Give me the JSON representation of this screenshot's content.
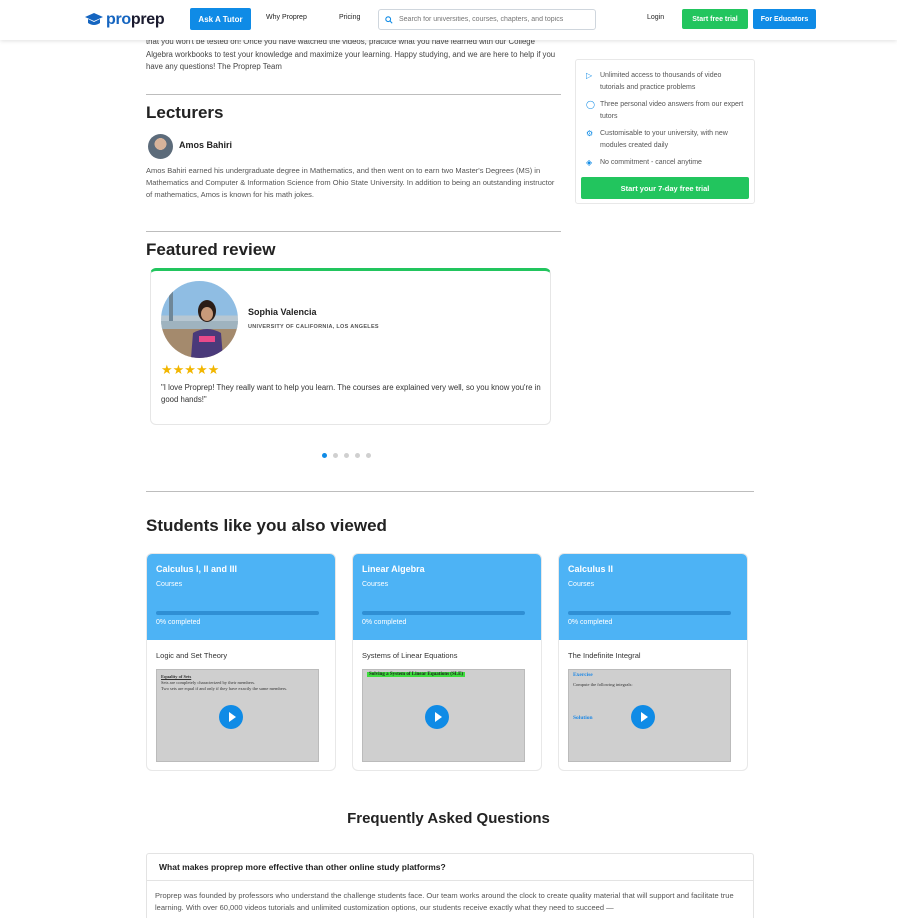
{
  "header": {
    "logo_text_1": "pro",
    "logo_text_2": "prep",
    "ask_tutor": "Ask A Tutor",
    "why_proprep": "Why Proprep",
    "pricing": "Pricing",
    "search_placeholder": "Search for universities, courses, chapters, and topics",
    "login": "Login",
    "start_free_trial": "Start free trial",
    "for_educators": "For Educators"
  },
  "intro_text": "that you won't be tested on! Once you have watched the videos, practice what you have learned with our College Algebra workbooks to test your knowledge and maximize your learning. Happy studying, and we are here to help if you have any questions! The Proprep Team",
  "lecturers": {
    "title": "Lecturers",
    "name": "Amos Bahiri",
    "bio": "Amos Bahiri earned his undergraduate degree in Mathematics, and then went on to earn two Master's Degrees (MS) in Mathematics and Computer & Information Science from Ohio State University. In addition to being an outstanding instructor of mathematics, Amos is known for his math jokes."
  },
  "review": {
    "title": "Featured review",
    "name": "Sophia Valencia",
    "school": "UNIVERSITY OF CALIFORNIA, LOS ANGELES",
    "stars": "★★★★★",
    "rating": 5,
    "text": "\"I love Proprep! They really want to help you learn. The courses are explained very well, so you know you're in good hands!\"",
    "active_slide": 1,
    "slide_count": 5
  },
  "sidebar": {
    "features": [
      "Unlimited access to thousands of video tutorials and practice problems",
      "Three personal video answers from our expert tutors",
      "Customisable to your university, with new modules created daily",
      "No commitment - cancel anytime"
    ],
    "cta": "Start your 7-day free trial"
  },
  "also_viewed": {
    "title": "Students like you also viewed",
    "courses": [
      {
        "title": "Calculus I, II and III",
        "sub": "Courses",
        "progress": "0% completed",
        "topic": "Logic and Set Theory",
        "thumb_lines": [
          "Equality of Sets",
          "Sets are completely characterized by their members.",
          "Two sets are equal if and only if they have exactly the same members."
        ]
      },
      {
        "title": "Linear Algebra",
        "sub": "Courses",
        "progress": "0% completed",
        "topic": "Systems of Linear Equations",
        "thumb_lines": [
          "Solving a System of Linear Equations (SLE)"
        ]
      },
      {
        "title": "Calculus II",
        "sub": "Courses",
        "progress": "0% completed",
        "topic": "The Indefinite Integral",
        "thumb_lines": [
          "Exercise",
          "Compute the following integrals:",
          "Solution"
        ]
      }
    ]
  },
  "faq": {
    "title": "Frequently Asked Questions",
    "question": "What makes proprep more effective than other online study platforms?",
    "answer": "Proprep was founded by professors who understand the challenge students face. Our team works around the clock to create quality material that will support and facilitate true learning. With over 60,000 videos tutorials and unlimited customization options, our students receive exactly what they need to succeed —"
  },
  "colors": {
    "brand_blue": "#0f8be6",
    "green": "#22c55e",
    "card_blue": "#4db3f5",
    "star": "#f2b600"
  }
}
